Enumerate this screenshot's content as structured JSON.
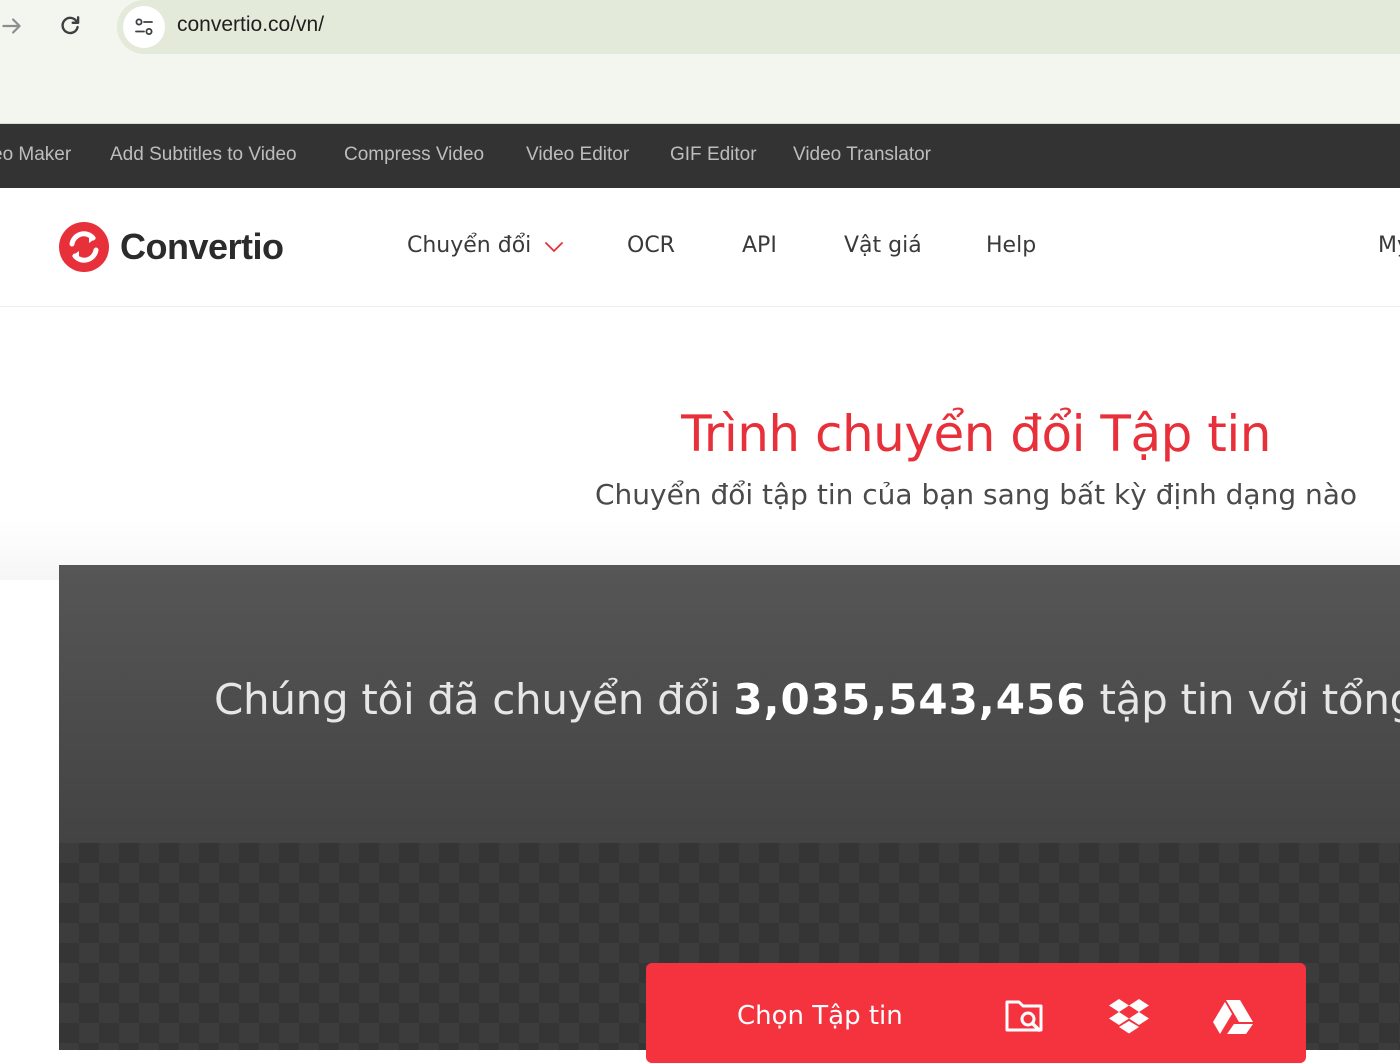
{
  "browser": {
    "url": "convertio.co/vn/"
  },
  "tools_strip": {
    "items": [
      {
        "label": "eo Maker"
      },
      {
        "label": "Add Subtitles to Video"
      },
      {
        "label": "Compress Video"
      },
      {
        "label": "Video Editor"
      },
      {
        "label": "GIF Editor"
      },
      {
        "label": "Video Translator"
      }
    ]
  },
  "header": {
    "logo_text": "Convertio",
    "menu": [
      {
        "label": "Chuyển đổi"
      },
      {
        "label": "OCR"
      },
      {
        "label": "API"
      },
      {
        "label": "Vật giá"
      },
      {
        "label": "Help"
      },
      {
        "label": "My"
      }
    ]
  },
  "hero": {
    "title": "Trình chuyển đổi Tập tin",
    "subtitle": "Chuyển đổi tập tin của bạn sang bất kỳ định dạng nào"
  },
  "stats": {
    "prefix": "Chúng tôi đã chuyển đổi ",
    "count": "3,035,543,456",
    "suffix": " tập tin với tổng dung lư"
  },
  "upload": {
    "choose_label": "Chọn Tập tin"
  },
  "colors": {
    "brand_red": "#f5333f",
    "title_red": "#e8303a",
    "dark_strip": "#333333"
  },
  "icons": [
    "arrow-forward-icon",
    "reload-icon",
    "site-settings-icon",
    "convertio-logo-icon",
    "chevron-down-icon",
    "folder-search-icon",
    "dropbox-icon",
    "google-drive-icon"
  ]
}
